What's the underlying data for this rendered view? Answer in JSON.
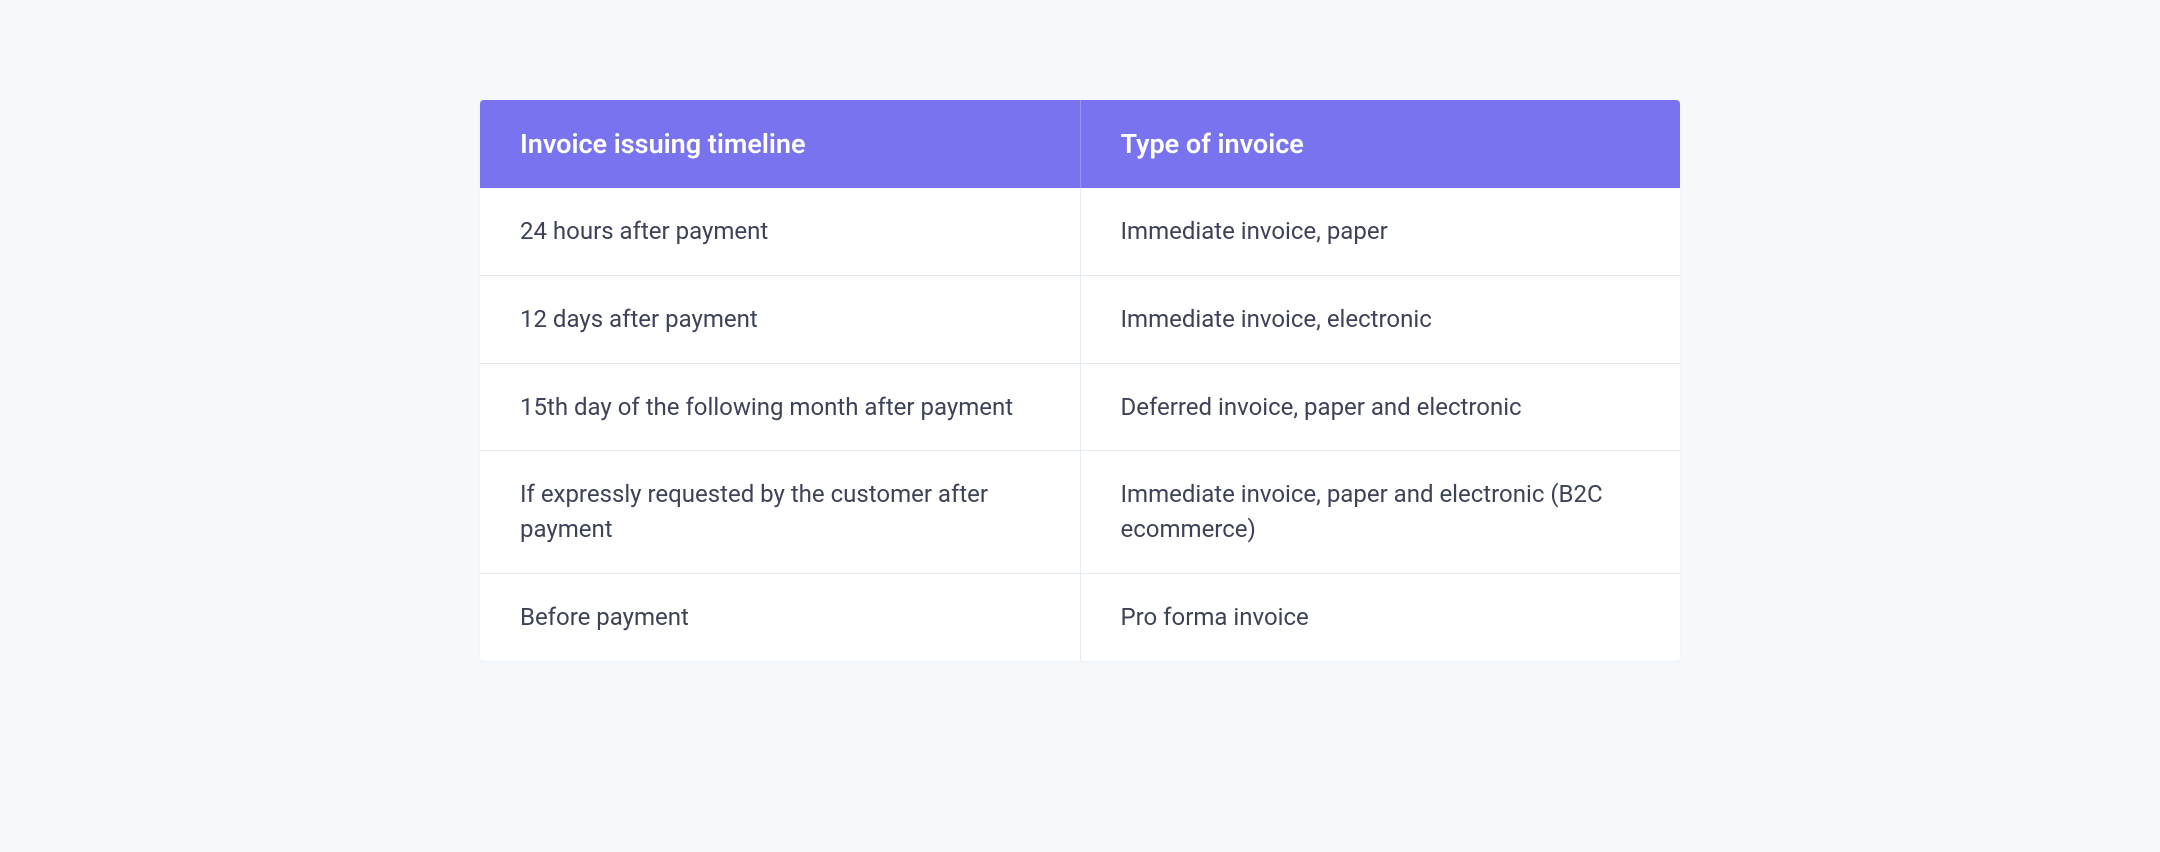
{
  "table": {
    "headers": [
      "Invoice issuing timeline",
      "Type of invoice"
    ],
    "rows": [
      {
        "timeline": "24 hours after payment",
        "type": "Immediate invoice, paper"
      },
      {
        "timeline": "12 days after payment",
        "type": "Immediate invoice, electronic"
      },
      {
        "timeline": "15th day of the following month after payment",
        "type": "Deferred invoice, paper and electronic"
      },
      {
        "timeline": "If expressly requested by the customer after payment",
        "type": "Immediate invoice, paper and electronic (B2C ecommerce)"
      },
      {
        "timeline": "Before payment",
        "type": "Pro forma invoice"
      }
    ]
  }
}
